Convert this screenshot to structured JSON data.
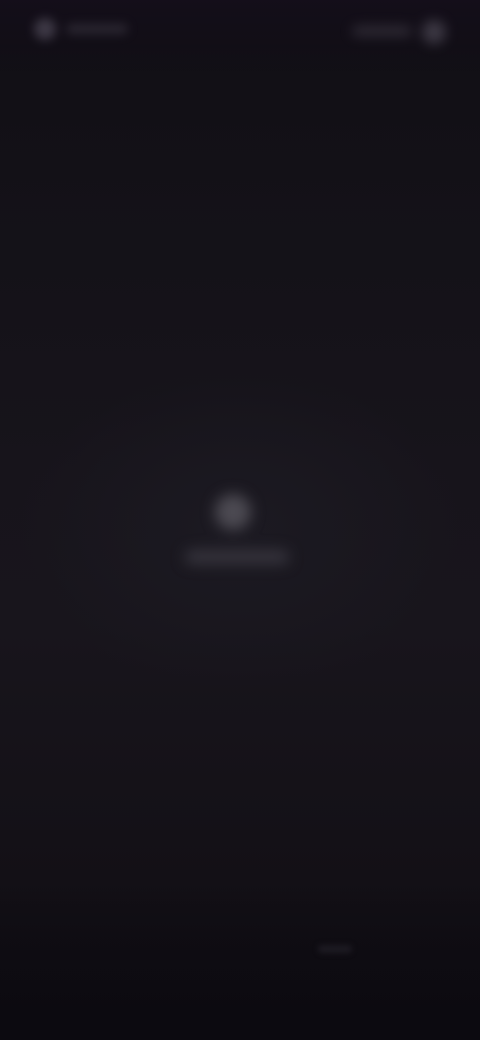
{
  "screen": {
    "state": "blurred",
    "background_color": "#15121a"
  },
  "top_bar": {
    "brand_logo": "app-logo-icon",
    "brand_name": "",
    "action_label": "",
    "action_icon": "profile-icon"
  },
  "center": {
    "icon": "loading-icon",
    "label": ""
  },
  "bottom": {
    "hint": ""
  }
}
